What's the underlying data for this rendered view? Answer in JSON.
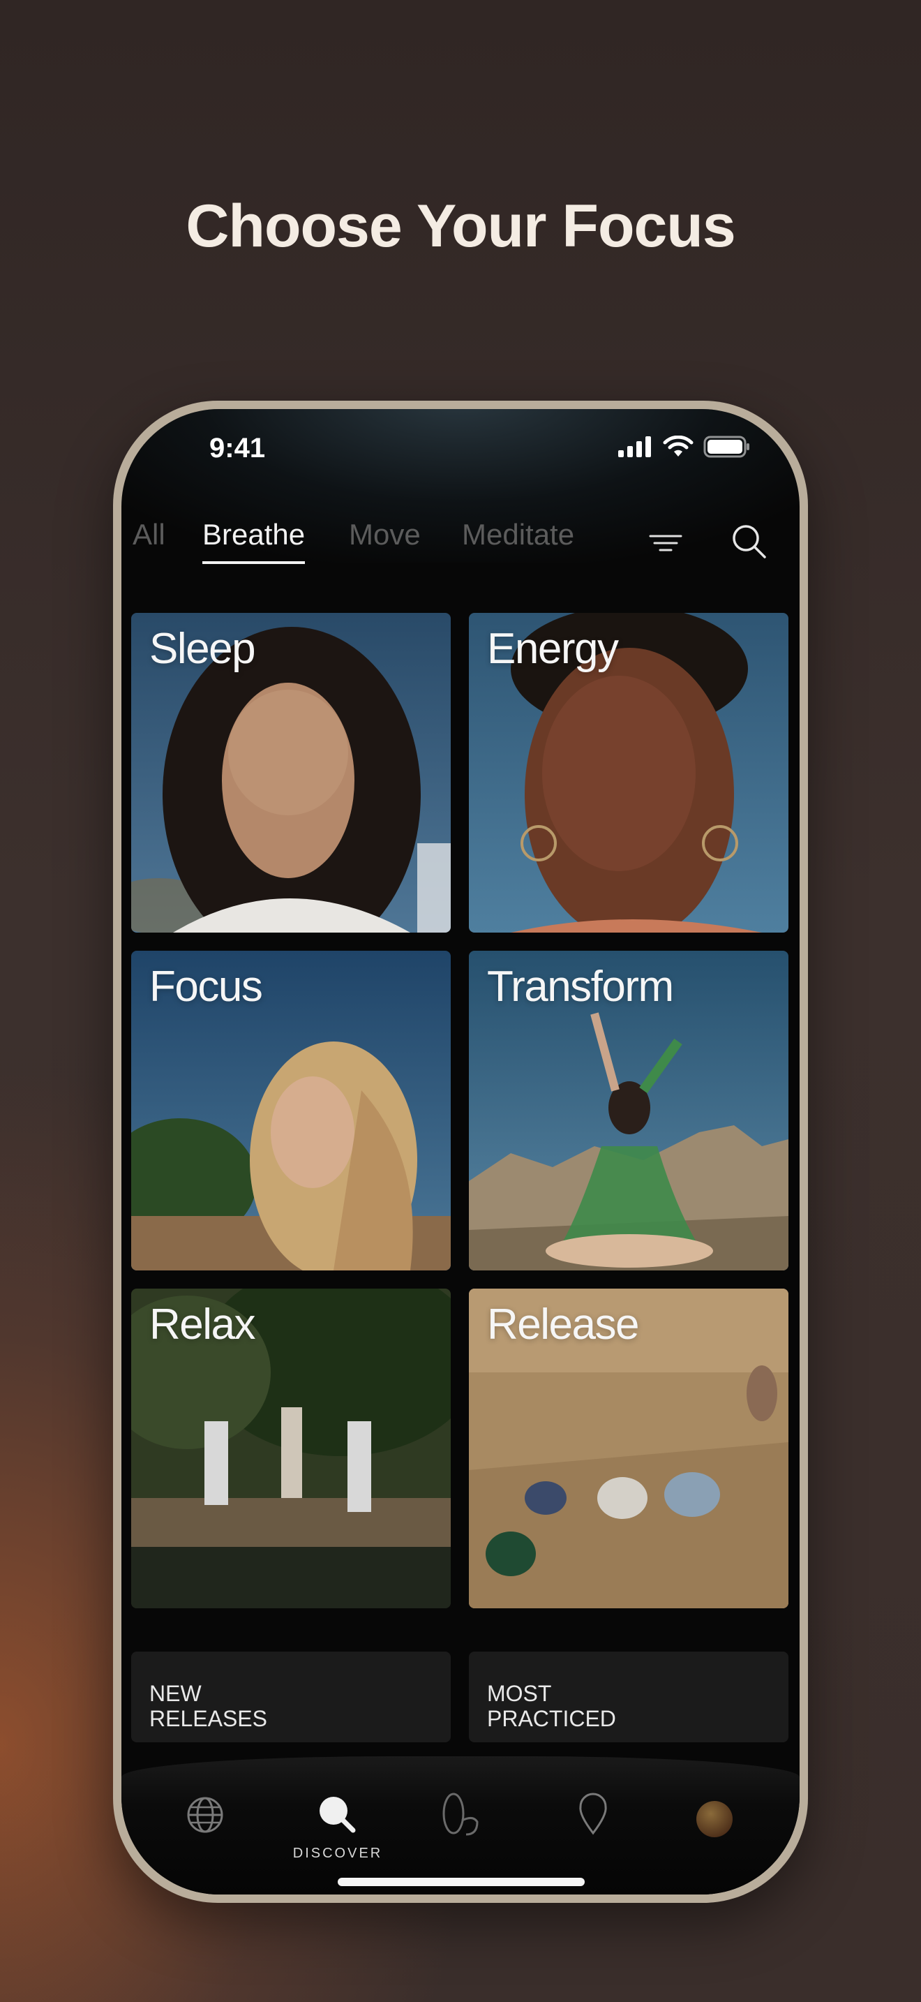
{
  "headline": "Choose Your Focus",
  "status_bar": {
    "time": "9:41",
    "icons": [
      "cellular-signal-icon",
      "wifi-icon",
      "battery-icon"
    ]
  },
  "tabs": [
    {
      "label": "All",
      "active": false
    },
    {
      "label": "Breathe",
      "active": true
    },
    {
      "label": "Move",
      "active": false
    },
    {
      "label": "Meditate",
      "active": false
    }
  ],
  "toolbar_icons": [
    "filter-icon",
    "search-icon"
  ],
  "focus_cards": [
    {
      "label": "Sleep"
    },
    {
      "label": "Energy"
    },
    {
      "label": "Focus"
    },
    {
      "label": "Transform"
    },
    {
      "label": "Relax"
    },
    {
      "label": "Release"
    }
  ],
  "collections": [
    {
      "label": "NEW\nRELEASES"
    },
    {
      "label": "MOST\nPRACTICED"
    }
  ],
  "bottom_nav": [
    {
      "icon": "globe-icon",
      "label": "",
      "active": false
    },
    {
      "icon": "search-icon",
      "label": "DISCOVER",
      "active": true
    },
    {
      "icon": "practice-icon",
      "label": "",
      "active": false
    },
    {
      "icon": "location-pin-icon",
      "label": "",
      "active": false
    },
    {
      "icon": "profile-avatar-icon",
      "label": "",
      "active": false
    }
  ],
  "colors": {
    "background": "#302624",
    "accent_warm": "#a8582e",
    "phone_frame": "#b9ad9b",
    "screen": "#070707",
    "text_primary": "#f2f2f2",
    "text_inactive": "#5c5c5c"
  }
}
